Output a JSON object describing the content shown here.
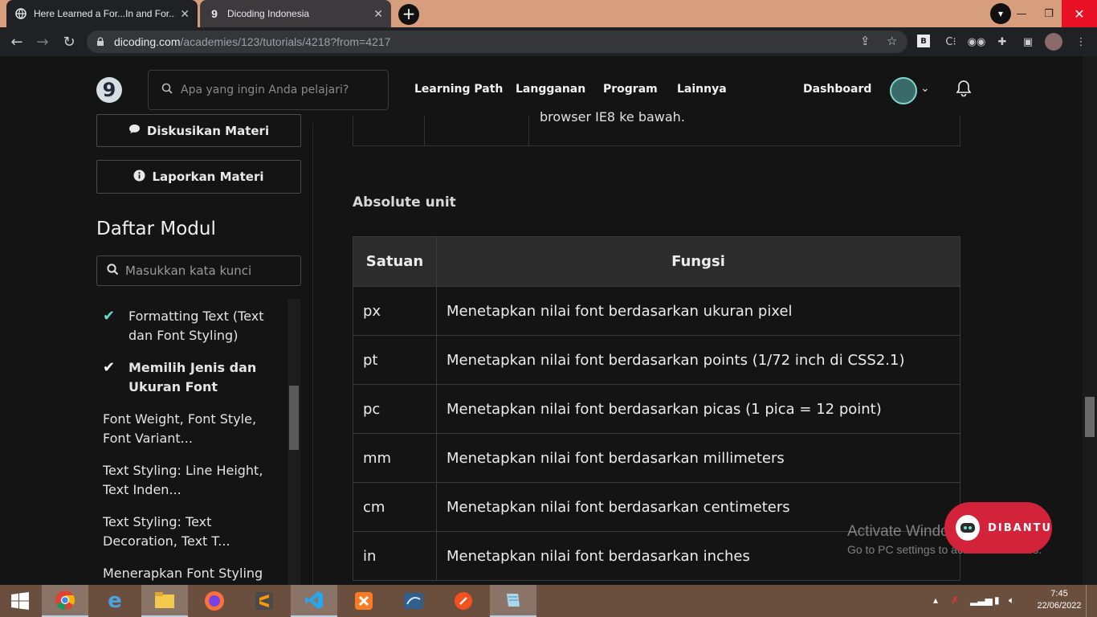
{
  "browser": {
    "tabs": [
      {
        "title": "Here Learned a For...In and For...O",
        "active": true,
        "favicon": "globe-icon"
      },
      {
        "title": "Dicoding Indonesia",
        "active": false,
        "favicon": "dicoding-icon"
      }
    ],
    "url_host": "dicoding.com",
    "url_path": "/academies/123/tutorials/4218?from=4217"
  },
  "site": {
    "logo": "9",
    "search_placeholder": "Apa yang ingin Anda pelajari?",
    "nav": [
      "Learning Path",
      "Langganan",
      "Program",
      "Lainnya"
    ],
    "dashboard": "Dashboard"
  },
  "sidebar": {
    "discuss_label": "Diskusikan Materi",
    "report_label": "Laporkan Materi",
    "module_title": "Daftar Modul",
    "module_search_placeholder": "Masukkan kata kunci",
    "items": [
      {
        "label": "Formatting Text (Text dan Font Styling)",
        "status": "done"
      },
      {
        "label": "Memilih Jenis dan Ukuran Font",
        "status": "current"
      },
      {
        "label": "Font Weight, Font Style, Font Variant...",
        "status": "todo"
      },
      {
        "label": "Text Styling: Line Height, Text Inden...",
        "status": "todo"
      },
      {
        "label": "Text Styling: Text Decoration, Text T...",
        "status": "todo"
      },
      {
        "label": "Menerapkan Font Styling",
        "status": "todo"
      }
    ]
  },
  "main": {
    "prev_table_tail": "browser IE8 ke bawah.",
    "section_title": "Absolute unit",
    "table": {
      "headers": [
        "Satuan",
        "Fungsi"
      ],
      "rows": [
        [
          "px",
          "Menetapkan nilai font berdasarkan ukuran pixel"
        ],
        [
          "pt",
          "Menetapkan nilai font berdasarkan points (1/72 inch di CSS2.1)"
        ],
        [
          "pc",
          "Menetapkan nilai font berdasarkan picas (1 pica = 12 point)"
        ],
        [
          "mm",
          "Menetapkan nilai font berdasarkan millimeters"
        ],
        [
          "cm",
          "Menetapkan nilai font berdasarkan centimeters"
        ],
        [
          "in",
          "Menetapkan nilai font berdasarkan inches"
        ]
      ]
    }
  },
  "watermark": {
    "line1": "Activate Windows",
    "line2": "Go to PC settings to activate Windows."
  },
  "dibantu": "DIBANTU",
  "taskbar": {
    "time": "7:45",
    "date": "22/06/2022"
  }
}
